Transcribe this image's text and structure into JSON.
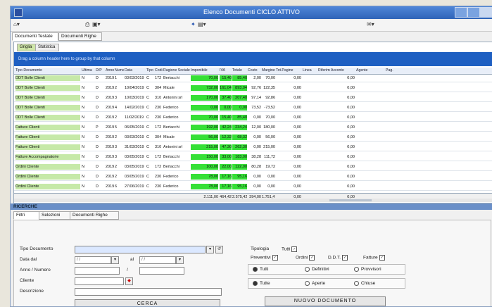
{
  "window": {
    "title": "Elenco Documenti CICLO ATTIVO"
  },
  "toolbar": {
    "icons": [
      "home-icon",
      "print-icon",
      "save-icon",
      "wand-icon",
      "doc-icon",
      "mail-icon"
    ]
  },
  "main_tabs": [
    "Documenti Testate",
    "Documenti Righe"
  ],
  "grid_tabs": [
    "Griglia",
    "Statistica"
  ],
  "group_hint": "Drag a column header here to group by that column",
  "columns": [
    "Tipo Documento",
    "Ultima",
    "D/P",
    "Anno",
    "Numero",
    "Data",
    "Tipo C/F",
    "Codice",
    "Ragione Sociale",
    "Imponibile",
    "IVA",
    "Totale",
    "Costo",
    "Margine",
    "Tot.Pagine",
    "Linea",
    "Riferimento",
    "Acconto",
    "Agente",
    "Pag."
  ],
  "rows": [
    [
      "DDT Bolle Clienti",
      "N",
      "D",
      "2019",
      "1",
      "03/03/2019",
      "C",
      "172",
      "Bertacchi",
      "70,00",
      "15,40",
      "85,40",
      "2,00",
      "70,00",
      "0,00",
      "",
      "",
      "0,00"
    ],
    [
      "DDT Bolle Clienti",
      "N",
      "D",
      "2019",
      "2",
      "10/04/2019",
      "C",
      "304",
      "Micale",
      "732,00",
      "161,04",
      "893,04",
      "92,76",
      "122,35",
      "0,00",
      "",
      "",
      "0,00"
    ],
    [
      "DDT Bolle Clienti",
      "N",
      "D",
      "2019",
      "3",
      "10/03/2019",
      "C",
      "310",
      "Antonini srl",
      "170,00",
      "37,40",
      "207,40",
      "97,14",
      "92,86",
      "0,00",
      "",
      "",
      "0,00"
    ],
    [
      "DDT Bolle Clienti",
      "N",
      "D",
      "2019",
      "4",
      "14/02/2019",
      "C",
      "230",
      "Federico",
      "0,00",
      "0,00",
      "0,00",
      "73,52",
      "-73,52",
      "0,00",
      "",
      "",
      "0,00"
    ],
    [
      "DDT Bolle Clienti",
      "N",
      "D",
      "2019",
      "2",
      "11/02/2019",
      "C",
      "230",
      "Federico",
      "70,00",
      "15,40",
      "85,40",
      "0,00",
      "70,00",
      "0,00",
      "",
      "",
      "0,00"
    ],
    [
      "Fatture Clienti",
      "N",
      "P",
      "2019",
      "5",
      "06/05/2019",
      "C",
      "172",
      "Bertacchi",
      "192,00",
      "42,24",
      "234,24",
      "12,00",
      "180,00",
      "0,00",
      "",
      "",
      "0,00"
    ],
    [
      "Fatture Clienti",
      "N",
      "D",
      "2019",
      "2",
      "03/03/2019",
      "C",
      "304",
      "Micale",
      "56,00",
      "12,32",
      "68,32",
      "0,00",
      "56,00",
      "0,00",
      "",
      "",
      "0,00"
    ],
    [
      "Fatture Clienti",
      "N",
      "D",
      "2019",
      "3",
      "31/03/2019",
      "C",
      "310",
      "Antonini srl",
      "215,00",
      "47,30",
      "262,30",
      "0,00",
      "215,00",
      "0,00",
      "",
      "",
      "0,00"
    ],
    [
      "Fatture Accompagnatorie",
      "N",
      "D",
      "2019",
      "3",
      "03/05/2019",
      "C",
      "172",
      "Bertacchi",
      "150,00",
      "33,00",
      "183,00",
      "38,28",
      "111,72",
      "0,00",
      "",
      "",
      "0,00"
    ],
    [
      "Ordini Cliente",
      "N",
      "D",
      "2019",
      "2",
      "03/05/2019",
      "C",
      "172",
      "Bertacchi",
      "100,00",
      "22,00",
      "122,00",
      "80,28",
      "19,72",
      "0,00",
      "",
      "",
      "0,00"
    ],
    [
      "Ordini Cliente",
      "N",
      "D",
      "2019",
      "2",
      "03/05/2019",
      "C",
      "230",
      "Federico",
      "78,00",
      "17,16",
      "95,16",
      "0,00",
      "0,00",
      "0,00",
      "",
      "",
      "0,00"
    ],
    [
      "Ordini Cliente",
      "N",
      "D",
      "2019",
      "6",
      "27/06/2019",
      "C",
      "230",
      "Federico",
      "78,00",
      "17,16",
      "95,16",
      "0,00",
      "0,00",
      "0,00",
      "",
      "",
      "0,00"
    ]
  ],
  "totals": [
    "2.111,00",
    "464,42",
    "2.575,42",
    "394,00",
    "1.751,47",
    "0,00",
    "0,00"
  ],
  "record_header": "RICERCHE",
  "filter_tabs": [
    "Filtri",
    "Selezioni",
    "Documenti Righe"
  ],
  "filters": {
    "tipo_documento_label": "Tipo Documento",
    "data_dal_label": "Data dal",
    "data_dal_value": "/ /",
    "data_al_label": "al",
    "data_al_value": "/ /",
    "anno_label": "Anno / Numero",
    "cliente_label": "Cliente",
    "descrizione_label": "Descrizione",
    "cerca_button": "CERCA",
    "tipologia_label": "Tipologia",
    "tutti_label": "Tutti",
    "preventivi_label": "Preventivi",
    "ordini_label": "Ordini",
    "ddt_label": "D.D.T.",
    "fatture_label": "Fatture",
    "radio1": [
      "Tutti",
      "Definitivi",
      "Provvisori"
    ],
    "radio2": [
      "Tutte",
      "Aperte",
      "Chiuse"
    ],
    "nuovo_button": "NUOVO DOCUMENTO"
  }
}
